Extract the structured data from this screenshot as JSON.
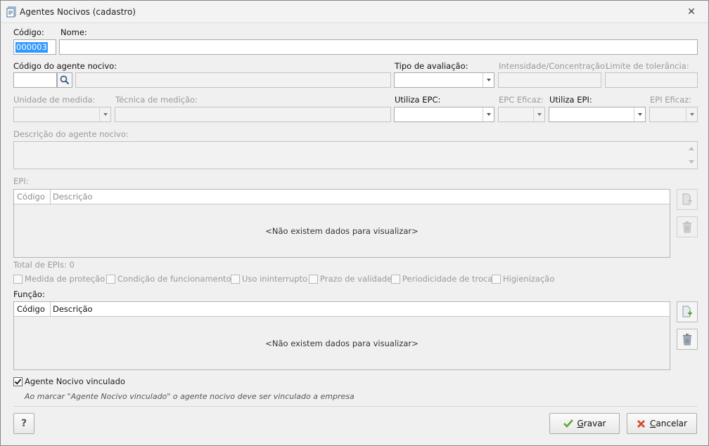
{
  "window": {
    "title": "Agentes Nocivos (cadastro)",
    "close_glyph": "✕"
  },
  "fields": {
    "codigo_label": "Código:",
    "codigo_value": "000003",
    "nome_label": "Nome:",
    "nome_value": "",
    "codigo_agente_label": "Código do agente nocivo:",
    "tipo_avaliacao_label": "Tipo de avaliação:",
    "intensidade_label": "Intensidade/Concentração:",
    "limite_label": "Limite de tolerância:",
    "unidade_label": "Unidade de medida:",
    "tecnica_label": "Técnica de medição:",
    "utiliza_epc_label": "Utiliza EPC:",
    "epc_eficaz_label": "EPC Eficaz:",
    "utiliza_epi_label": "Utiliza EPI:",
    "epi_eficaz_label": "EPI Eficaz:",
    "descricao_label": "Descrição do agente nocivo:"
  },
  "epi": {
    "section_label": "EPI:",
    "columns": [
      "Código",
      "Descrição"
    ],
    "empty_text": "<Não existem dados para visualizar>",
    "total_text": "Total de EPIs: 0",
    "checkboxes": [
      "Medida de proteção",
      "Condição de funcionamento",
      "Uso ininterrupto",
      "Prazo de validade",
      "Periodicidade de troca",
      "Higienização"
    ]
  },
  "funcao": {
    "section_label": "Função:",
    "columns": [
      "Código",
      "Descrição"
    ],
    "empty_text": "<Não existem dados para visualizar>"
  },
  "vinculado": {
    "label": "Agente Nocivo vinculado",
    "checked": true,
    "note": "Ao marcar \"Agente Nocivo vinculado\" o agente nocivo deve ser vinculado a empresa"
  },
  "buttons": {
    "help": "?",
    "gravar_underlined": "G",
    "gravar_rest": "ravar",
    "cancelar_underlined": "C",
    "cancelar_rest": "ancelar"
  },
  "icons": {
    "app": "document-icon",
    "search": "magnifier-icon",
    "add": "add-document-icon",
    "delete": "trash-icon",
    "confirm": "green-check-icon",
    "cancel": "red-x-icon"
  },
  "colors": {
    "selection": "#3399ff",
    "gravar_check": "#5aa832",
    "cancel_x": "#d94a2b"
  }
}
